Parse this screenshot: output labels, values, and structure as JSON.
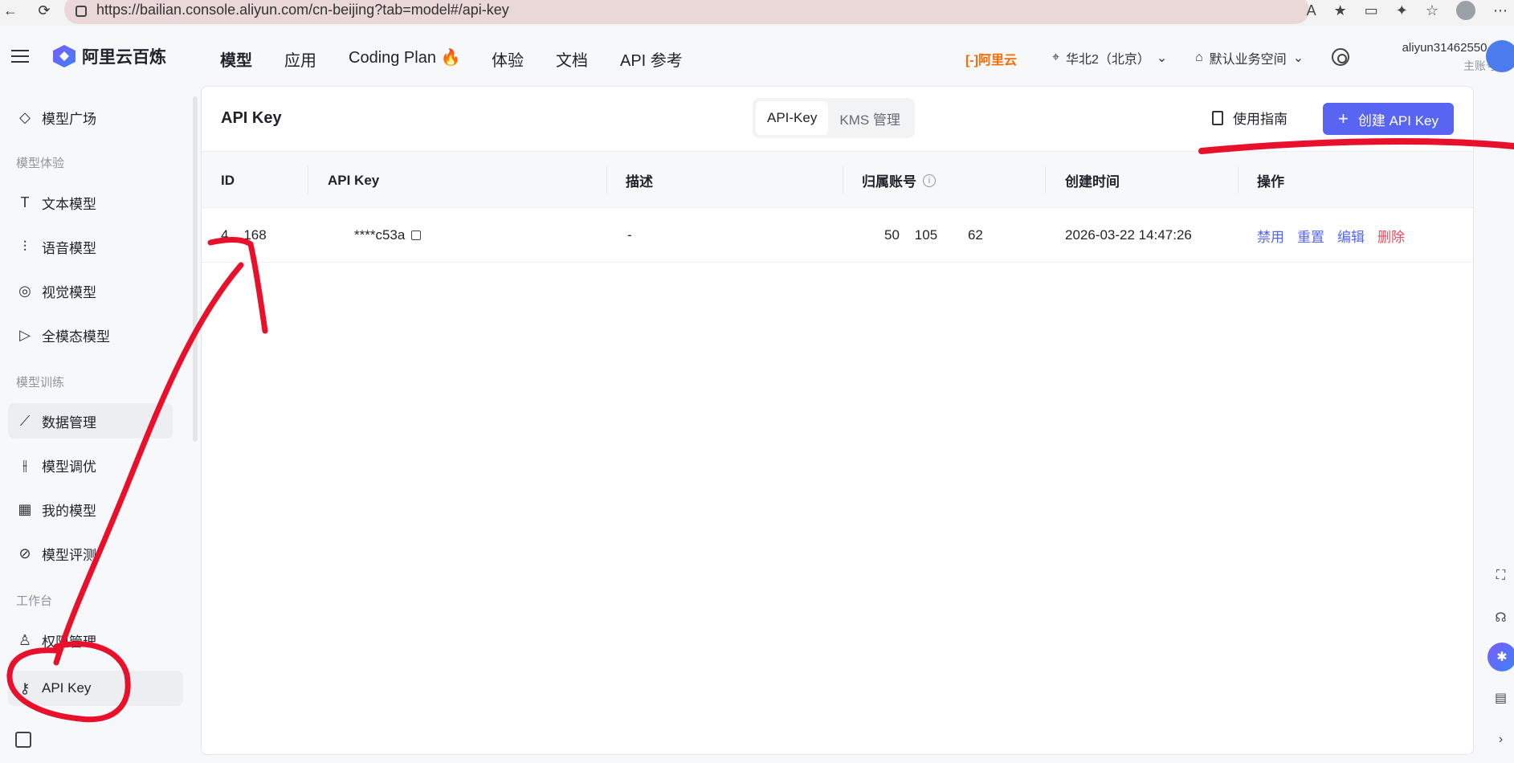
{
  "browser": {
    "url": "https://bailian.console.aliyun.com/cn-beijing?tab=model#/api-key"
  },
  "topnav": {
    "brand": "阿里云百炼",
    "items": [
      {
        "label": "模型"
      },
      {
        "label": "应用"
      },
      {
        "label": "Coding Plan 🔥"
      },
      {
        "label": "体验"
      },
      {
        "label": "文档"
      },
      {
        "label": "API 参考"
      }
    ],
    "aliyun_logo": "[-]阿里云",
    "region": "华北2（北京）",
    "workspace": "默认业务空间",
    "account_name": "aliyun31462550...",
    "account_role": "主账号"
  },
  "sidebar": {
    "top_item": "模型广场",
    "group_experience": "模型体验",
    "experience_items": [
      "文本模型",
      "语音模型",
      "视觉模型",
      "全模态模型"
    ],
    "group_training": "模型训练",
    "training_items": [
      "数据管理",
      "模型调优",
      "我的模型",
      "模型评测"
    ],
    "group_workbench": "工作台",
    "workbench_items": [
      "权限管理",
      "API Key"
    ]
  },
  "panel": {
    "title": "API Key",
    "tabs": [
      "API-Key",
      "KMS 管理"
    ],
    "guide_label": "使用指南",
    "create_label": "创建 API Key"
  },
  "table": {
    "headers": [
      "ID",
      "API Key",
      "描述",
      "归属账号",
      "创建时间",
      "操作"
    ],
    "rows": [
      {
        "id": "4    168",
        "api_key": "****c53a",
        "description": "-",
        "account": "50    105        62",
        "created": "2026-03-22 14:47:26",
        "actions": [
          "禁用",
          "重置",
          "编辑",
          "删除"
        ]
      }
    ]
  },
  "colors": {
    "accent": "#5865f2",
    "danger": "#f5455c",
    "annotation": "#e8102a"
  }
}
